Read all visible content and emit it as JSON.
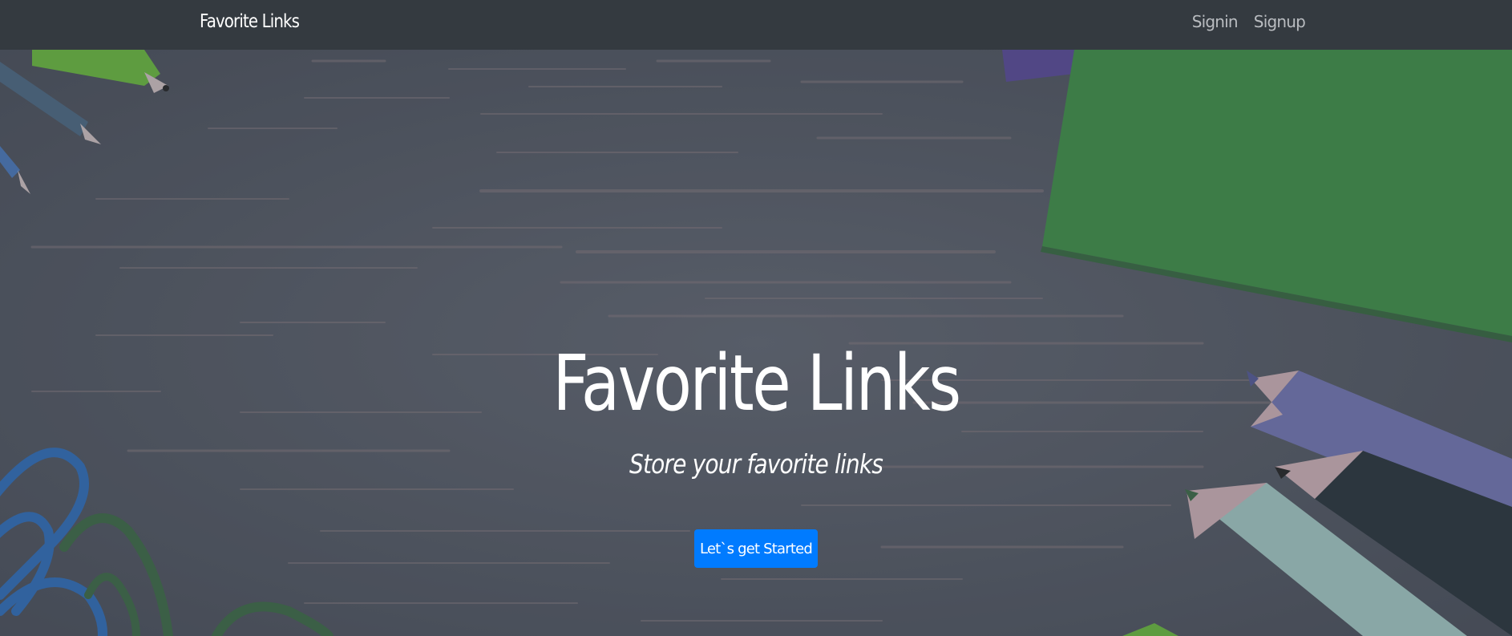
{
  "navbar": {
    "brand": "Favorite Links",
    "links": [
      {
        "label": "Signin"
      },
      {
        "label": "Signup"
      }
    ]
  },
  "hero": {
    "title": "Favorite Links",
    "subtitle": "Store your favorite links",
    "cta_label": "Let`s get Started"
  },
  "colors": {
    "navbar": "#343a40",
    "button": "#007bff",
    "background": "#555a66"
  }
}
